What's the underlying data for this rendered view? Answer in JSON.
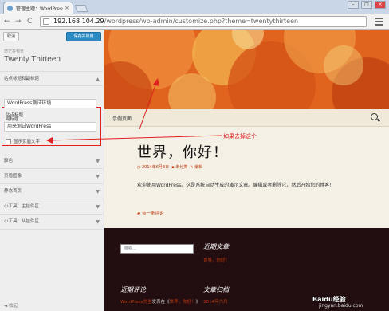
{
  "browser": {
    "tab_title": "管理主题：WordPress测",
    "tab_close": "×",
    "url_host": "192.168.104.29",
    "url_path": "/wordpress/wp-admin/customize.php?theme=twentythirteen",
    "back": "←",
    "forward": "→",
    "reload": "C",
    "win_min": "–",
    "win_max": "□",
    "win_close": "×"
  },
  "customizer": {
    "cancel_label": "取消",
    "save_label": "保存并启用",
    "customizing_label": "您正在预览",
    "theme_name": "Twenty Thirteen",
    "sections": [
      {
        "label": "站点标题和副标题",
        "chevron": "▲"
      },
      {
        "label": "颜色",
        "chevron": "▼"
      },
      {
        "label": "页眉图像",
        "chevron": "▼"
      },
      {
        "label": "静态首页",
        "chevron": "▼"
      },
      {
        "label": "小工具：主挂件区",
        "chevron": "▼"
      },
      {
        "label": "小工具：从挂件区",
        "chevron": "▼"
      }
    ],
    "site_title_label": "站点标题",
    "site_title_value": "WordPress测试环境",
    "tagline_label": "副标题",
    "tagline_value": "用来测试WordPress",
    "display_header_text_label": "显示页眉文字",
    "display_header_text_checked": false,
    "collapse_label": "收起"
  },
  "preview": {
    "nav_home": "示例页面",
    "post_title": "世界，你好！",
    "post_date": "2014年6月3日",
    "post_category": "未分类",
    "post_edit": "编辑",
    "post_body": "欢迎使用WordPress。这是系统自动生成的演示文章。编辑或者删除它，然后开始您的博客！",
    "post_comment": "有一条评论",
    "footer": {
      "search_placeholder": "搜索…",
      "recent_posts_title": "近期文章",
      "recent_posts_item": "世界，你好！",
      "recent_comments_title": "近期评论",
      "recent_comment_author": "WordPress先生",
      "recent_comment_on": "发表在《",
      "recent_comment_post": "世界，你好！",
      "recent_comment_end": "》",
      "archives_title": "文章归档",
      "archives_item": "2014年六月"
    }
  },
  "annotation": {
    "callout_text": "如果去掉这个",
    "color": "#e02020"
  },
  "watermark": {
    "brand": "Baidu经验",
    "site": "jingyan.baidu.com"
  },
  "colors": {
    "header_orange": "#e0631e",
    "save_blue": "#2e8ac3",
    "footer_dark": "#220e10",
    "link_red": "#bc360a"
  }
}
